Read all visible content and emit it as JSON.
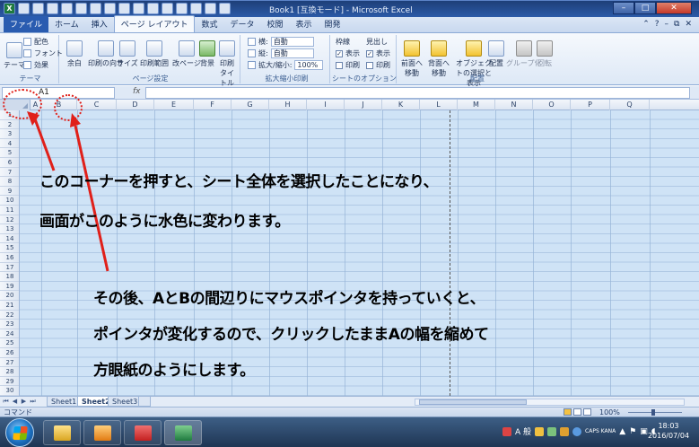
{
  "window": {
    "title": "Book1 [互換モード] - Microsoft Excel",
    "minimize_icon": "minimize-icon",
    "maximize_icon": "maximize-icon",
    "close_icon": "close-icon"
  },
  "ribbon_tabs": [
    {
      "label": "ファイル"
    },
    {
      "label": "ホーム"
    },
    {
      "label": "挿入"
    },
    {
      "label": "ページ レイアウト"
    },
    {
      "label": "数式"
    },
    {
      "label": "データ"
    },
    {
      "label": "校閲"
    },
    {
      "label": "表示"
    },
    {
      "label": "開発"
    }
  ],
  "ribbon": {
    "theme_group": {
      "label": "テーマ",
      "theme_button": "テーマ",
      "colors": "配色",
      "fonts": "フォント",
      "effects": "効果"
    },
    "page_setup_group": {
      "label": "ページ設定",
      "margins": "余白",
      "orientation": "印刷の向き",
      "size": "サイズ",
      "print_area": "印刷範囲",
      "breaks": "改ページ",
      "background": "背景",
      "print_titles": "印刷タイトル"
    },
    "scale_group": {
      "label": "拡大縮小印刷",
      "width_label": "横:",
      "width_value": "自動",
      "height_label": "縦:",
      "height_value": "自動",
      "scale_label": "拡大/縮小:",
      "scale_value": "100%"
    },
    "sheet_options_group": {
      "label": "シートのオプション",
      "gridlines": "枠線",
      "headings": "見出し",
      "view": "表示",
      "print": "印刷"
    },
    "arrange_group": {
      "label": "配置",
      "bring_forward": "前面へ移動",
      "send_backward": "背面へ移動",
      "selection_pane": "オブジェクトの選択と表示",
      "align": "配置",
      "group": "グループ化",
      "rotate": "回転"
    }
  },
  "formula_bar": {
    "name_box": "A1",
    "fx": "fx",
    "formula": ""
  },
  "columns": [
    "A",
    "B",
    "C",
    "D",
    "E",
    "F",
    "G",
    "H",
    "I",
    "J",
    "K",
    "L",
    "M",
    "N",
    "O",
    "P",
    "Q"
  ],
  "rows": [
    "1",
    "2",
    "3",
    "4",
    "5",
    "6",
    "7",
    "8",
    "9",
    "10",
    "11",
    "12",
    "13",
    "14",
    "15",
    "16",
    "17",
    "18",
    "19",
    "20",
    "21",
    "22",
    "23",
    "24",
    "25",
    "26",
    "27",
    "28",
    "29",
    "30"
  ],
  "annotations": {
    "line1": "このコーナーを押すと、シート全体を選択したことになり、",
    "line2": "画面がこのように水色に変わります。",
    "line3": "その後、AとBの間辺りにマウスポインタを持っていくと、",
    "line4": "ポインタが変化するので、クリックしたままAの幅を縮めて",
    "line5": "方眼紙のようにします。",
    "accent_color": "#e0201a"
  },
  "sheets": [
    {
      "label": "Sheet1"
    },
    {
      "label": "Sheet2"
    },
    {
      "label": "Sheet3"
    }
  ],
  "status": {
    "mode": "コマンド",
    "zoom": "100%"
  },
  "taskbar": {
    "ime": "A 般",
    "caps": "CAPS KANA",
    "time": "18:03",
    "date": "2016/07/04"
  }
}
